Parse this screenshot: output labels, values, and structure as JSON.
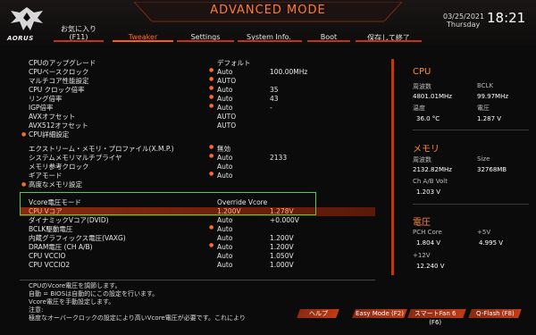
{
  "header": {
    "brand": "AORUS",
    "mode_title": "ADVANCED MODE",
    "date": "03/25/2021",
    "day": "Thursday",
    "time": "18:21",
    "tabs": [
      {
        "label": "お気に入り",
        "sub": "(F11)"
      },
      {
        "label": "Tweaker",
        "sub": ""
      },
      {
        "label": "Settings",
        "sub": ""
      },
      {
        "label": "System Info.",
        "sub": ""
      },
      {
        "label": "Boot",
        "sub": ""
      },
      {
        "label": "保存して終了",
        "sub": ""
      }
    ]
  },
  "settings": [
    {
      "label": "CPUのアップグレード",
      "value": "デフォルト",
      "value2": "",
      "dot": false,
      "bullet": false
    },
    {
      "label": "CPUベースクロック",
      "value": "Auto",
      "value2": "100.00MHz",
      "dot": true,
      "bullet": false
    },
    {
      "label": "マルチコア性能設定",
      "value": "AUTO",
      "value2": "",
      "dot": true,
      "bullet": false
    },
    {
      "label": "CPU クロック倍率",
      "value": "Auto",
      "value2": "35",
      "dot": true,
      "bullet": false
    },
    {
      "label": "リング倍率",
      "value": "Auto",
      "value2": "43",
      "dot": true,
      "bullet": false
    },
    {
      "label": "IGP倍率",
      "value": "Auto",
      "value2": "-",
      "dot": true,
      "bullet": false
    },
    {
      "label": "AVXオフセット",
      "value": "AUTO",
      "value2": "",
      "dot": false,
      "bullet": false
    },
    {
      "label": "AVX512オフセット",
      "value": "AUTO",
      "value2": "",
      "dot": false,
      "bullet": false
    },
    {
      "label": "CPU詳細設定",
      "value": "",
      "value2": "",
      "dot": false,
      "bullet": true
    },
    {
      "label": "エクストリーム・メモリ・プロファイル(X.M.P.)",
      "value": "無効",
      "value2": "",
      "dot": true,
      "bullet": false
    },
    {
      "label": "システムメモリマルチプライヤ",
      "value": "Auto",
      "value2": "2133",
      "dot": true,
      "bullet": false
    },
    {
      "label": "メモリ参考クロック",
      "value": "Auto",
      "value2": "",
      "dot": false,
      "bullet": false
    },
    {
      "label": "ギアモード",
      "value": "Auto",
      "value2": "",
      "dot": true,
      "bullet": false
    },
    {
      "label": "高度なメモリ設定",
      "value": "",
      "value2": "",
      "dot": false,
      "bullet": true
    },
    {
      "label": "Vcore電圧モード",
      "value": "Override Vcore",
      "value2": "",
      "dot": false,
      "bullet": false
    },
    {
      "label": "CPU Vコア",
      "value": "1.200V",
      "value2": "1.278V",
      "dot": false,
      "bullet": false
    },
    {
      "label": "ダイナミックVコア(DVID)",
      "value": "Auto",
      "value2": "+0.000V",
      "dot": false,
      "bullet": false
    },
    {
      "label": "BCLK駆動電圧",
      "value": "Auto",
      "value2": "",
      "dot": true,
      "bullet": false
    },
    {
      "label": "内蔵グラフィックス電圧(VAXG)",
      "value": "Auto",
      "value2": "1.200V",
      "dot": false,
      "bullet": false
    },
    {
      "label": "DRAM電圧 (CH A/B)",
      "value": "Auto",
      "value2": "1.200V",
      "dot": true,
      "bullet": false
    },
    {
      "label": "CPU VCCIO",
      "value": "Auto",
      "value2": "1.050V",
      "dot": false,
      "bullet": false
    },
    {
      "label": "CPU VCCIO2",
      "value": "Auto",
      "value2": "1.000V",
      "dot": false,
      "bullet": false
    }
  ],
  "panel": {
    "cpu": {
      "title": "CPU",
      "freq_label": "周波数",
      "freq_value": "4801.01MHz",
      "bclk_label": "BCLK",
      "bclk_value": "99.97MHz",
      "temp_label": "温度",
      "temp_value": "36.0 °C",
      "volt_label": "電圧",
      "volt_value": "1.287 V"
    },
    "memory": {
      "title": "メモリ",
      "freq_label": "周波数",
      "freq_value": "2132.82MHz",
      "size_label": "Size",
      "size_value": "32768MB",
      "chvolt_label": "Ch A/B Volt",
      "chvolt_value": "1.203 V"
    },
    "voltage": {
      "title": "電圧",
      "pch_label": "PCH Core",
      "pch_value": "1.804 V",
      "p5v_label": "+5V",
      "p5v_value": "4.995 V",
      "p12v_label": "+12V",
      "p12v_value": "12.240 V"
    }
  },
  "help": [
    "CPUのVcore電圧を調節します。",
    "自動 = BIOSは自動的にこの設定を行います。",
    "Vcore電圧を手動設定します。",
    "注意:",
    "極度なオーバークロックの設定により高いVcore電圧が必要です。これにより"
  ],
  "footer": {
    "help_btn": "ヘルプ",
    "easy_btn": "Easy Mode (F2)",
    "smartfan_btn": "スマートFan 6 (F6)",
    "qflash_btn": "Q-Flash (F8)"
  },
  "colors": {
    "accent": "#ff6a2c",
    "highlight": "#c8320c",
    "selection_box": "#4cd04c"
  }
}
